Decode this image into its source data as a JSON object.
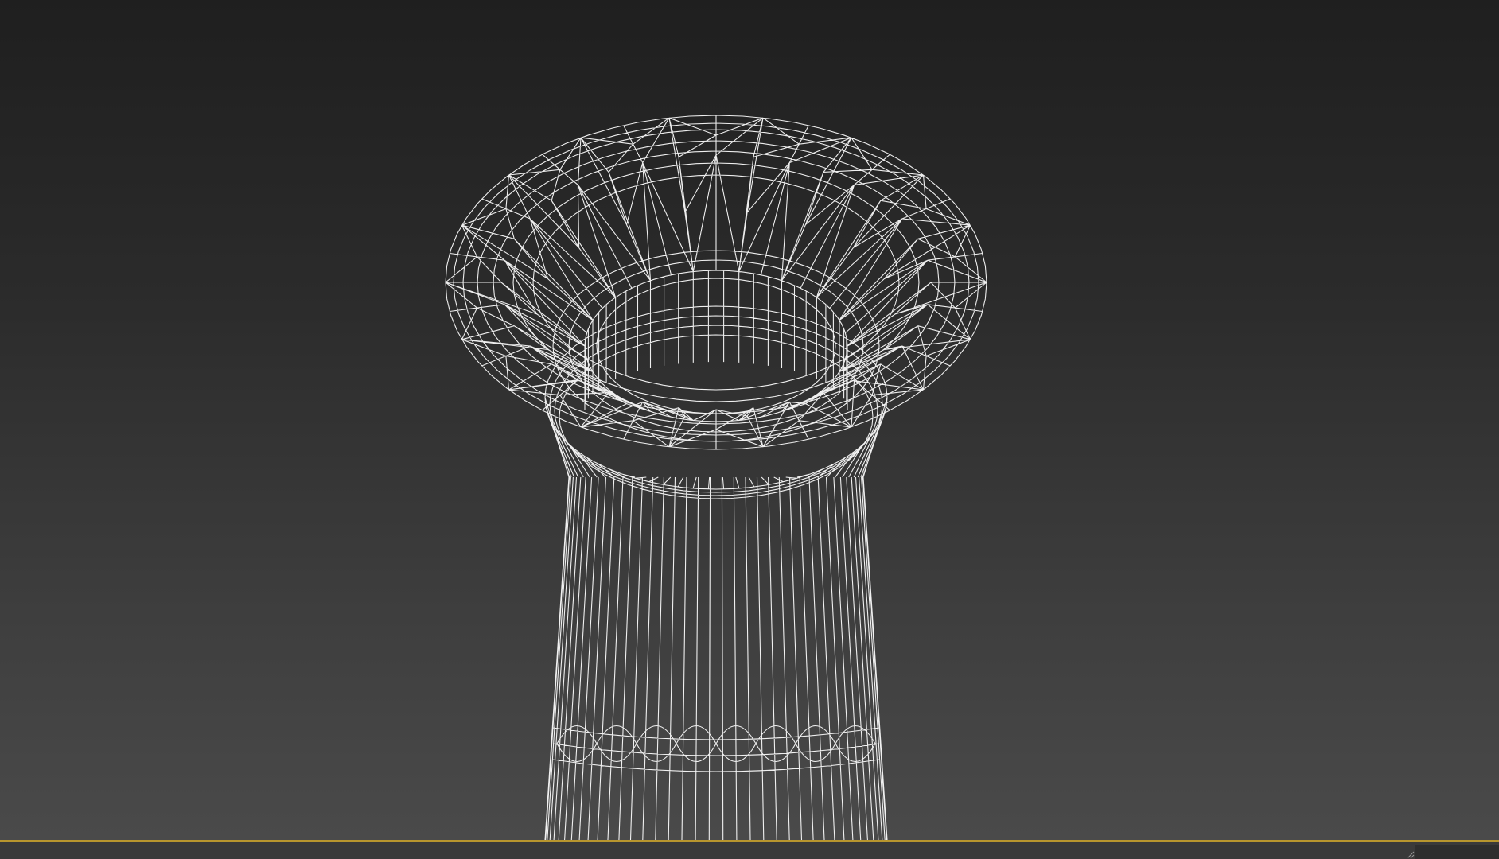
{
  "viewport": {
    "icons": [
      "wireframe-mesh-icon"
    ],
    "colors": {
      "background_top": "#1f1f1f",
      "background_bottom": "#4a4a4a",
      "wire": "#ffffff",
      "active_border": "#b8962e",
      "timebar": "#3a3a3a"
    }
  },
  "statusbar": {
    "icons": [
      "resize-grip-icon"
    ]
  }
}
